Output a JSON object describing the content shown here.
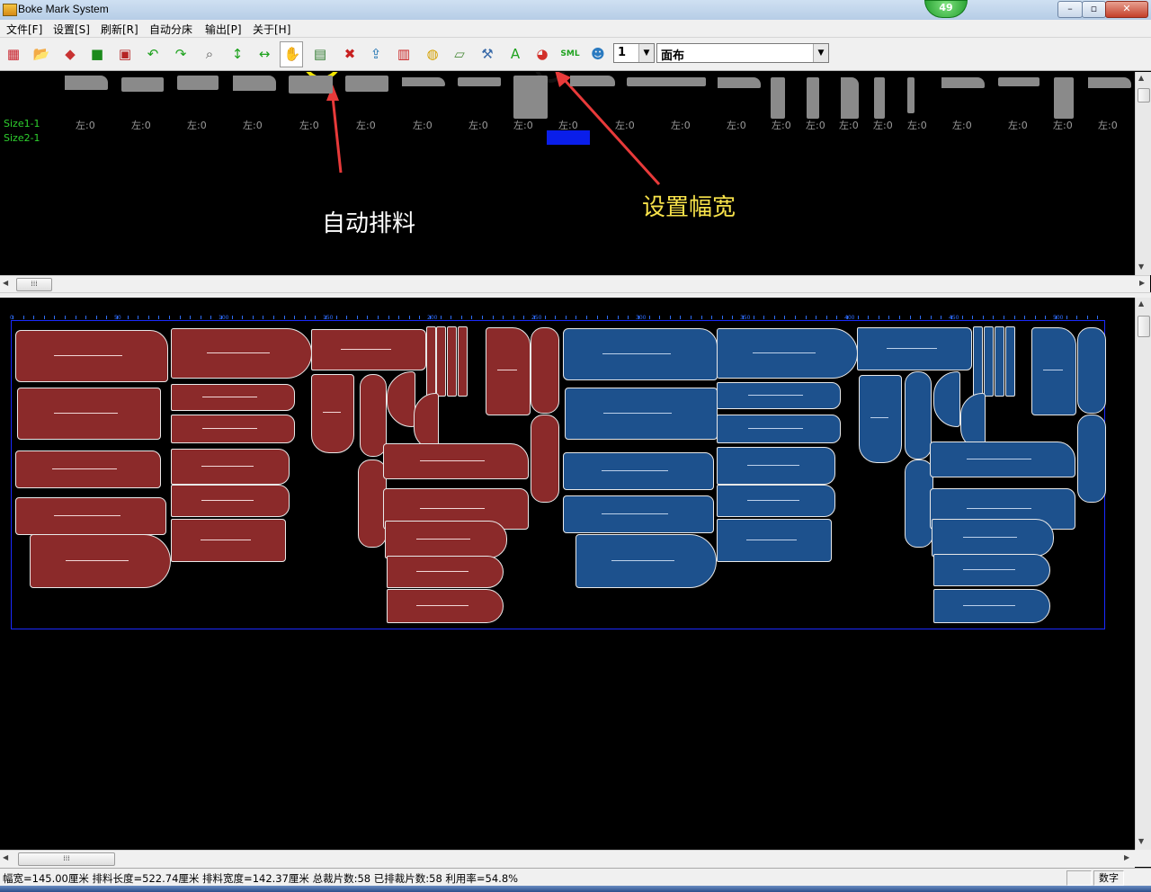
{
  "window": {
    "title": "Boke Mark System",
    "notification_count": "49",
    "controls": {
      "minimize": "–",
      "maximize": "▫",
      "close": "✕"
    }
  },
  "menu": [
    "文件[F]",
    "设置[S]",
    "刷新[R]",
    "自动分床",
    "输出[P]",
    "关于[H]"
  ],
  "toolbar": {
    "tools": [
      {
        "name": "new-marker-icon",
        "glyph": "▦",
        "color": "#c8202a"
      },
      {
        "name": "open-folder-icon",
        "glyph": "📂",
        "color": "#2a8a2a"
      },
      {
        "name": "import-pieces-icon",
        "glyph": "◆",
        "color": "#c83232"
      },
      {
        "name": "save-icon",
        "glyph": "■",
        "color": "#1c8a1c"
      },
      {
        "name": "save-as-icon",
        "glyph": "▣",
        "color": "#b52424"
      },
      {
        "name": "undo-icon",
        "glyph": "↶",
        "color": "#1ea21e"
      },
      {
        "name": "redo-icon",
        "glyph": "↷",
        "color": "#1ea21e"
      },
      {
        "name": "zoom-icon",
        "glyph": "⌕",
        "color": "#555555"
      },
      {
        "name": "vertical-move-icon",
        "glyph": "↕",
        "color": "#1ea21e"
      },
      {
        "name": "horizontal-move-icon",
        "glyph": "↔",
        "color": "#1ea21e"
      },
      {
        "name": "hand-pan-icon",
        "glyph": "✋",
        "color": "#c23a3a"
      },
      {
        "name": "auto-nesting-icon",
        "glyph": "▤",
        "color": "#2f7a2f"
      },
      {
        "name": "clear-marker-icon",
        "glyph": "✖",
        "color": "#c82020"
      },
      {
        "name": "export-icon",
        "glyph": "⇪",
        "color": "#1a6fb0"
      },
      {
        "name": "fabric-layout-icon",
        "glyph": "▥",
        "color": "#c82020"
      },
      {
        "name": "measure-tape-icon",
        "glyph": "◍",
        "color": "#d4a000"
      },
      {
        "name": "ruler-icon",
        "glyph": "▱",
        "color": "#4a8a3a"
      },
      {
        "name": "tools-icon",
        "glyph": "⚒",
        "color": "#3a6aa8"
      },
      {
        "name": "text-icon",
        "glyph": "A",
        "color": "#1ea21e"
      },
      {
        "name": "set-fabric-width-icon",
        "glyph": "◕",
        "color": "#d2302a"
      },
      {
        "name": "sml-icon",
        "glyph": "SML",
        "color": "#1ea21e"
      },
      {
        "name": "users-icon",
        "glyph": "☻",
        "color": "#2a7ac0"
      }
    ],
    "combo_number": "1",
    "combo_fabric": "面布"
  },
  "annotations": {
    "auto_nesting": "自动排料",
    "set_width": "设置幅宽"
  },
  "upper_panel": {
    "size_labels": [
      "Size1-1",
      "Size2-1"
    ],
    "side_label": "左:0",
    "side_label_count": 19
  },
  "marker": {
    "ruler_labels": [
      "0",
      "50",
      "100",
      "150",
      "200",
      "250",
      "300",
      "350",
      "400",
      "450",
      "500"
    ]
  },
  "scroll": {
    "upper_thumb": "⁞⁞⁞",
    "lower_thumb": "⁞⁞⁞"
  },
  "status": {
    "summary": "幅宽=145.00厘米 排料长度=522.74厘米 排料宽度=142.37厘米 总裁片数:58 已排裁片数:58 利用率=54.8%",
    "mode": "数字"
  },
  "colors": {
    "size1": "#8b2a2a",
    "size2": "#1d518d",
    "label_green": "#2ed02e",
    "width_annotation": "#f7e24a"
  }
}
